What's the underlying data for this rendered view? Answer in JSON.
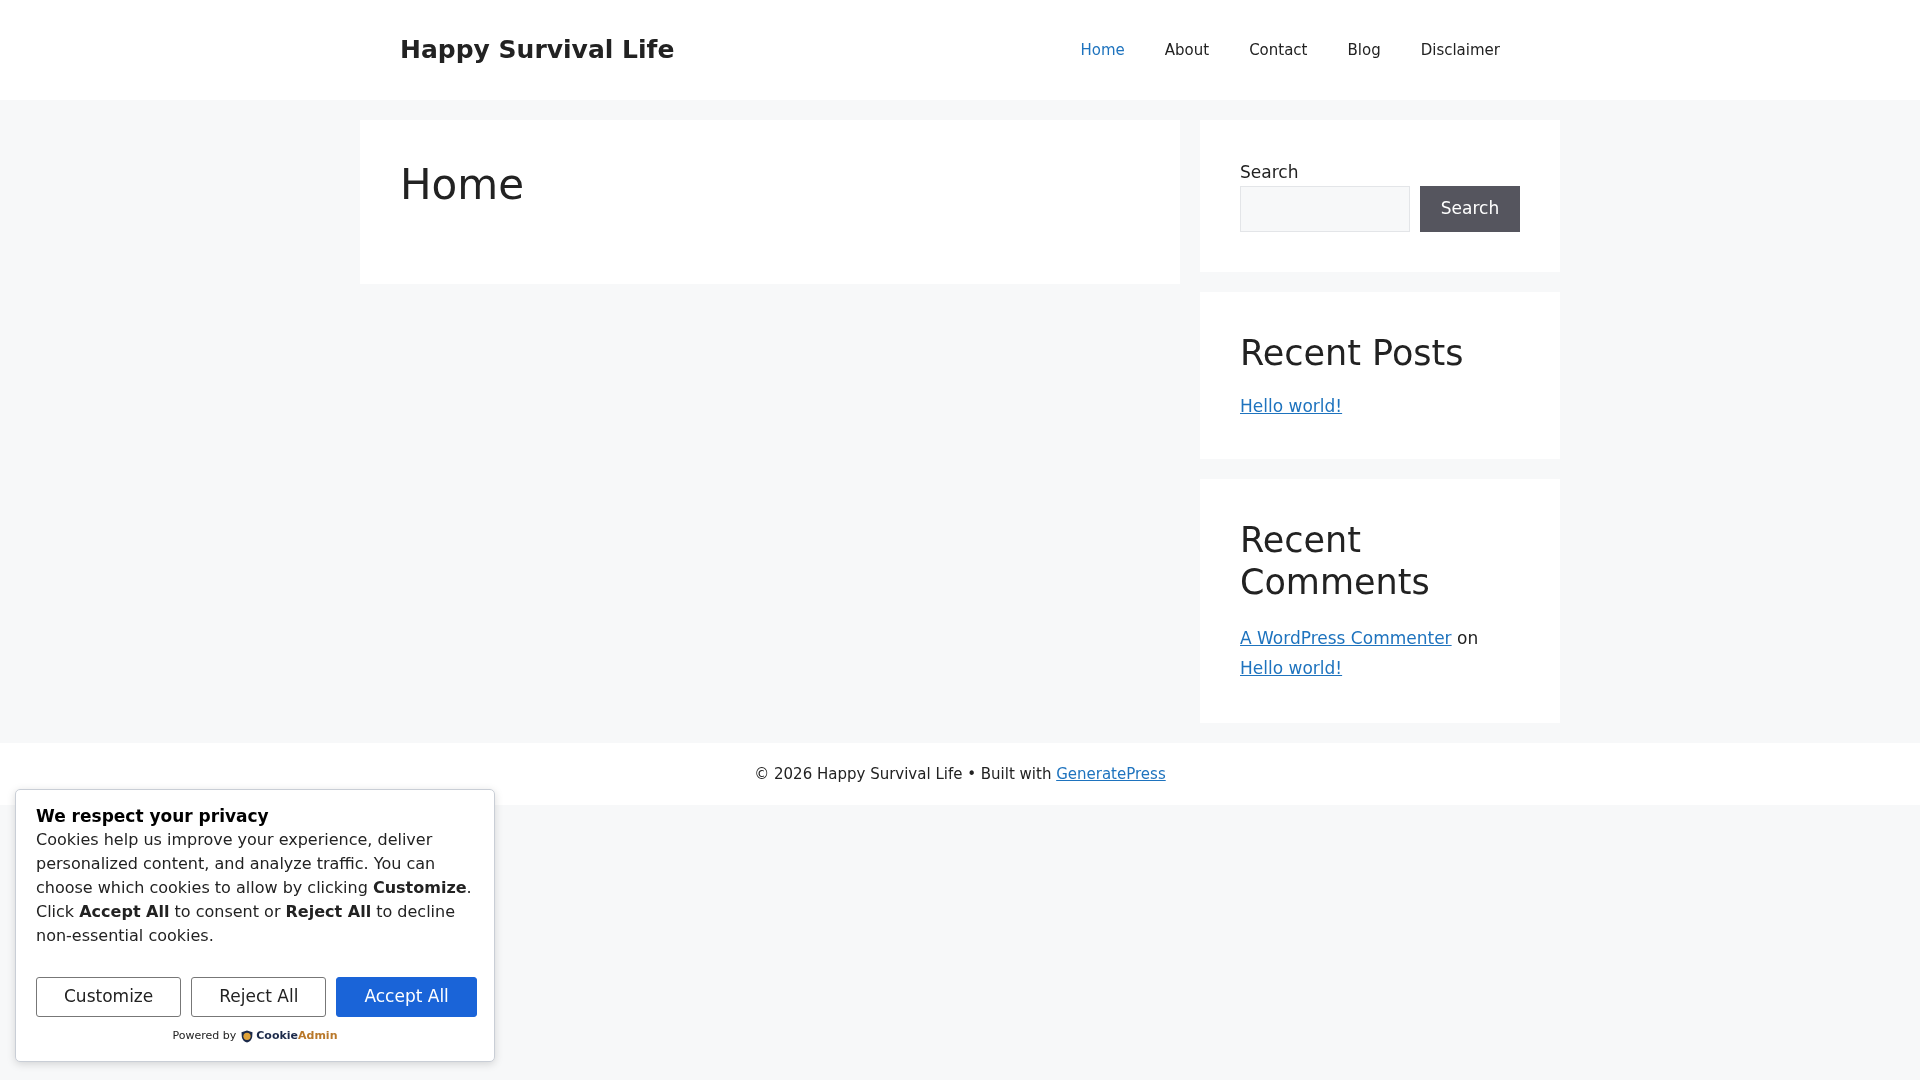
{
  "header": {
    "site_title": "Happy Survival Life",
    "nav": [
      {
        "label": "Home",
        "selected": true
      },
      {
        "label": "About",
        "selected": false
      },
      {
        "label": "Contact",
        "selected": false
      },
      {
        "label": "Blog",
        "selected": false
      },
      {
        "label": "Disclaimer",
        "selected": false
      }
    ]
  },
  "main": {
    "page_title": "Home"
  },
  "sidebar": {
    "search_widget": {
      "label": "Search",
      "button": "Search"
    },
    "recent_posts": {
      "title": "Recent Posts",
      "items": [
        "Hello world!"
      ]
    },
    "recent_comments": {
      "title": "Recent Comments",
      "items": [
        {
          "author": "A WordPress Commenter",
          "connector": "on",
          "post": "Hello world!"
        }
      ]
    }
  },
  "footer": {
    "text": "© 2026 Happy Survival Life • Built with",
    "link": "GeneratePress"
  },
  "cookie_banner": {
    "title": "We respect your privacy",
    "body": "Cookies help us improve your experience, deliver personalized content, and analyze traffic. You can choose which cookies to allow by clicking **Customize**. Click **Accept All** to consent or **Reject All** to decline non-essential cookies.",
    "buttons": [
      {
        "label": "Customize",
        "kind": "outline"
      },
      {
        "label": "Reject All",
        "kind": "outline"
      },
      {
        "label": "Accept All",
        "kind": "primary"
      }
    ],
    "powered_by": {
      "label": "Powered by",
      "brand_parts": [
        {
          "text": "Cookie",
          "color": "#1c2a4a"
        },
        {
          "text": "Admin",
          "color": "#b9782a"
        }
      ]
    }
  }
}
